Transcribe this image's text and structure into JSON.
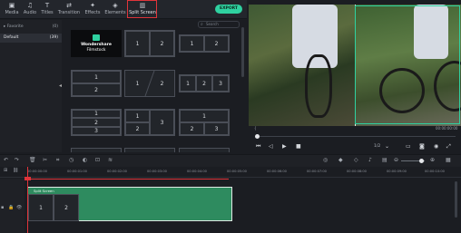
{
  "tabs": [
    {
      "label": "Media",
      "icon": "▣"
    },
    {
      "label": "Audio",
      "icon": "♫"
    },
    {
      "label": "Titles",
      "icon": "T"
    },
    {
      "label": "Transition",
      "icon": "⇄"
    },
    {
      "label": "Effects",
      "icon": "✦"
    },
    {
      "label": "Elements",
      "icon": "◈"
    },
    {
      "label": "Split Screen",
      "icon": "▥"
    }
  ],
  "export_label": "EXPORT",
  "sidebar": {
    "items": [
      {
        "label": "Favorite",
        "count": "(0)"
      },
      {
        "label": "Default",
        "count": "(39)"
      }
    ]
  },
  "search": {
    "placeholder": "Search"
  },
  "templates": [
    {
      "type": "brand",
      "line1": "Wondershare",
      "line2": "Filmstock"
    },
    {
      "type": "split2v",
      "cells": [
        "1",
        "2"
      ]
    },
    {
      "type": "split2v-small",
      "cells": [
        "1",
        "2"
      ]
    },
    {
      "type": "split2h",
      "cells": [
        "1",
        "2"
      ]
    },
    {
      "type": "split2diag",
      "cells": [
        "1",
        "2"
      ]
    },
    {
      "type": "split3v",
      "cells": [
        "1",
        "2",
        "3"
      ]
    },
    {
      "type": "split3h",
      "cells": [
        "1",
        "2",
        "3"
      ]
    },
    {
      "type": "split3mix",
      "cells": [
        "1",
        "2",
        "3"
      ]
    },
    {
      "type": "split3top",
      "cells": [
        "1",
        "2",
        "3"
      ]
    }
  ],
  "preview": {
    "timecode_left": "{",
    "timecode_right": "00:00:00:00",
    "ratio": "1/2"
  },
  "ruler_ticks": [
    "00:00:00:00",
    "00:00:01:00",
    "00:00:02:00",
    "00:00:03:00",
    "00:00:04:00",
    "00:00:05:00",
    "00:00:06:00",
    "00:00:07:00",
    "00:00:08:00",
    "00:00:09:00",
    "00:00:10:00"
  ],
  "clip": {
    "label": "Split Screen",
    "cells": [
      "1",
      "2"
    ]
  }
}
